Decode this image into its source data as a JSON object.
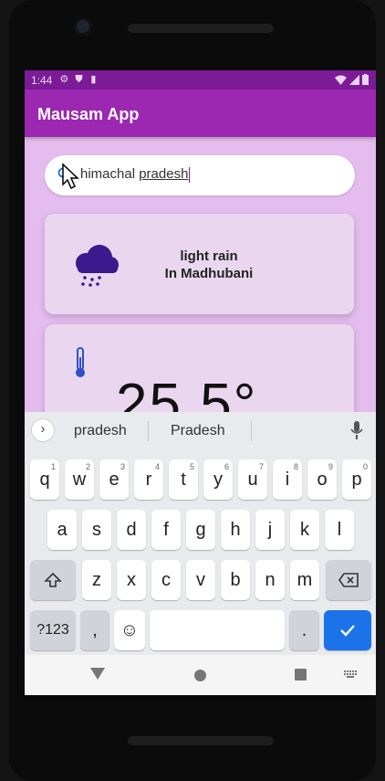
{
  "status_bar": {
    "time": "1:44"
  },
  "app": {
    "title": "Mausam App"
  },
  "search": {
    "value_prefix": "himachal ",
    "value_underlined": "pradesh",
    "icon": "search-icon"
  },
  "weather_card": {
    "condition": "light rain",
    "location": "In Madhubani",
    "icon": "rain-cloud-icon"
  },
  "temp_card": {
    "icon": "thermometer-icon",
    "value": "25.5°"
  },
  "keyboard": {
    "suggestions": [
      "pradesh",
      "Pradesh"
    ],
    "row1": [
      {
        "k": "q",
        "n": "1"
      },
      {
        "k": "w",
        "n": "2"
      },
      {
        "k": "e",
        "n": "3"
      },
      {
        "k": "r",
        "n": "4"
      },
      {
        "k": "t",
        "n": "5"
      },
      {
        "k": "y",
        "n": "6"
      },
      {
        "k": "u",
        "n": "7"
      },
      {
        "k": "i",
        "n": "8"
      },
      {
        "k": "o",
        "n": "9"
      },
      {
        "k": "p",
        "n": "0"
      }
    ],
    "row2": [
      "a",
      "s",
      "d",
      "f",
      "g",
      "h",
      "j",
      "k",
      "l"
    ],
    "row3": [
      "z",
      "x",
      "c",
      "v",
      "b",
      "n",
      "m"
    ],
    "symbols_label": "?123",
    "comma": ",",
    "period": ".",
    "emoji": "☺"
  },
  "colors": {
    "status": "#7b1b96",
    "appbar": "#9c27b0",
    "background": "#e4bdee",
    "card": "#ead7ef",
    "enter": "#1a73e8"
  }
}
